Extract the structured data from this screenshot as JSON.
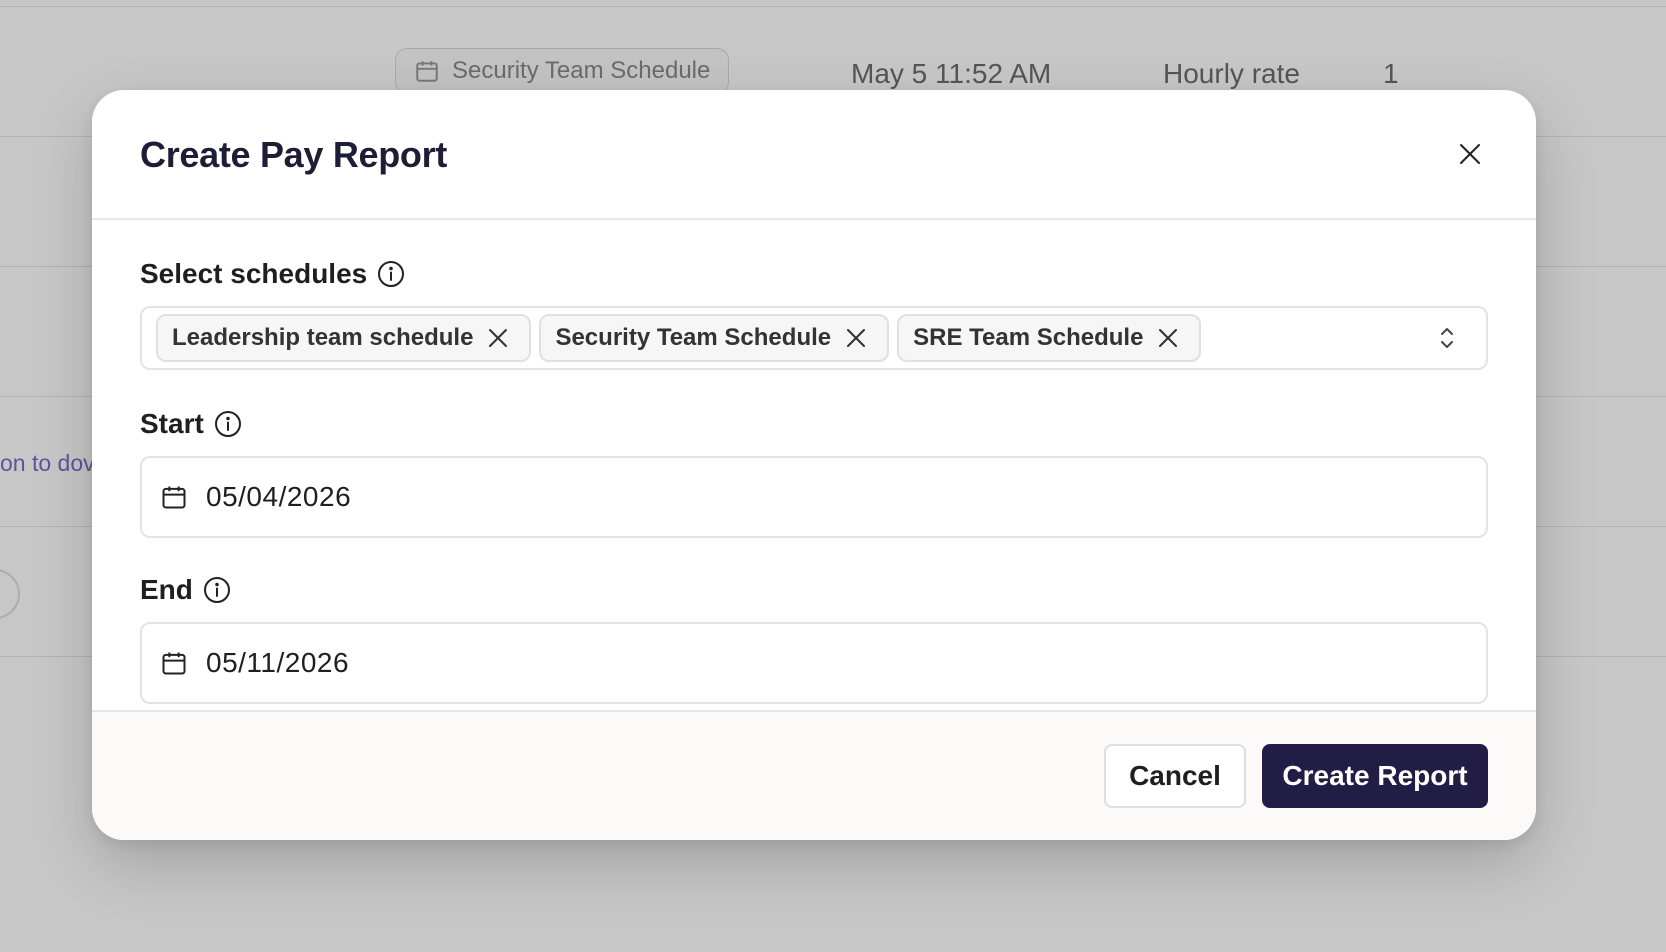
{
  "background": {
    "row": {
      "schedule_chip": "Security Team Schedule",
      "timestamp": "May 5 11:52 AM",
      "rate_type": "Hourly rate",
      "count": "1"
    },
    "link_fragment": "on to dov"
  },
  "modal": {
    "title": "Create Pay Report",
    "schedules": {
      "label": "Select schedules",
      "selected": [
        "Leadership team schedule",
        "Security Team Schedule",
        "SRE Team Schedule"
      ]
    },
    "start": {
      "label": "Start",
      "value": "05/04/2026"
    },
    "end": {
      "label": "End",
      "value": "05/11/2026"
    },
    "footer": {
      "cancel_label": "Cancel",
      "submit_label": "Create Report"
    }
  },
  "colors": {
    "primary_button": "#211d45",
    "title_text": "#1f1d36",
    "background_link": "#7d6bc4"
  },
  "icons": {
    "close": "close-icon",
    "info": "info-icon",
    "chip_remove": "close-icon",
    "select_toggle": "chevron-up-down-icon",
    "date": "calendar-icon"
  }
}
